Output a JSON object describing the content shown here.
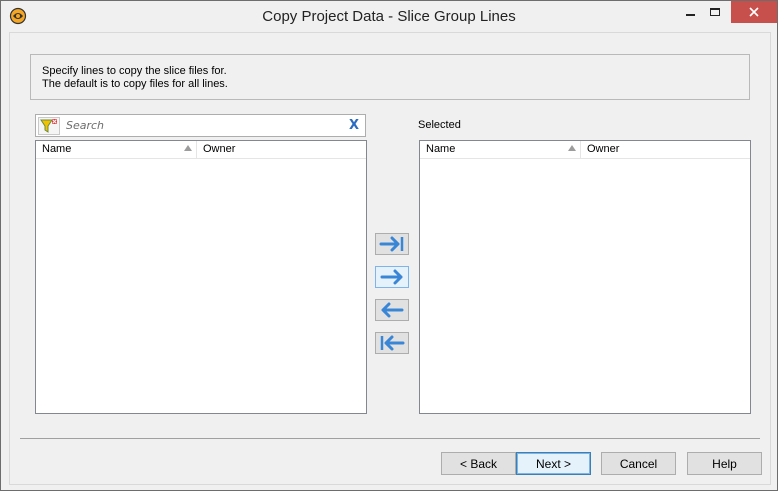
{
  "window": {
    "title": "Copy Project Data - Slice Group Lines"
  },
  "info": {
    "line1": "Specify lines to copy the slice files for.",
    "line2": "The default is to copy files for all lines."
  },
  "search": {
    "placeholder": "Search",
    "value": "",
    "clear_label": "X"
  },
  "available_list": {
    "columns": [
      {
        "label": "Name"
      },
      {
        "label": "Owner"
      }
    ],
    "rows": []
  },
  "selected_list": {
    "label": "Selected",
    "columns": [
      {
        "label": "Name"
      },
      {
        "label": "Owner"
      }
    ],
    "rows": []
  },
  "transfer_buttons": {
    "icons": [
      "arrow-right-to-bar-icon",
      "arrow-right-icon",
      "arrow-left-icon",
      "arrow-left-to-bar-icon"
    ]
  },
  "footer": {
    "back_label": "< Back",
    "next_label": "Next >",
    "cancel_label": "Cancel",
    "help_label": "Help"
  },
  "colors": {
    "arrow": "#3a86d6",
    "close_button": "#c7504c",
    "clear_x": "#2a6dc0"
  }
}
